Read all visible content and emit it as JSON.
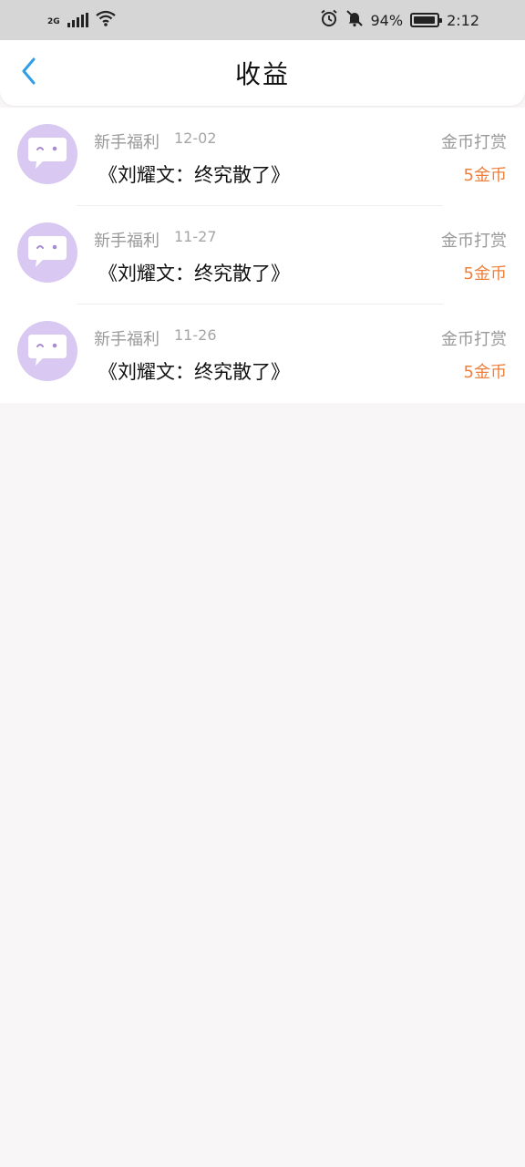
{
  "status": {
    "network": "2G",
    "battery": "94%",
    "time": "2:12"
  },
  "header": {
    "title": "收益"
  },
  "items": [
    {
      "source": "新手福利",
      "date": "12-02",
      "book": "《刘耀文：终究散了》",
      "action": "金币打赏",
      "amount": "5金币"
    },
    {
      "source": "新手福利",
      "date": "11-27",
      "book": "《刘耀文：终究散了》",
      "action": "金币打赏",
      "amount": "5金币"
    },
    {
      "source": "新手福利",
      "date": "11-26",
      "book": "《刘耀文：终究散了》",
      "action": "金币打赏",
      "amount": "5金币"
    }
  ],
  "colors": {
    "accent": "#2f9ee8",
    "amount": "#ee7f3b",
    "avatar_bg": "#d9c8f2"
  },
  "icons": {
    "back": "chevron-left-icon",
    "avatar": "chat-bubble-face-icon"
  }
}
